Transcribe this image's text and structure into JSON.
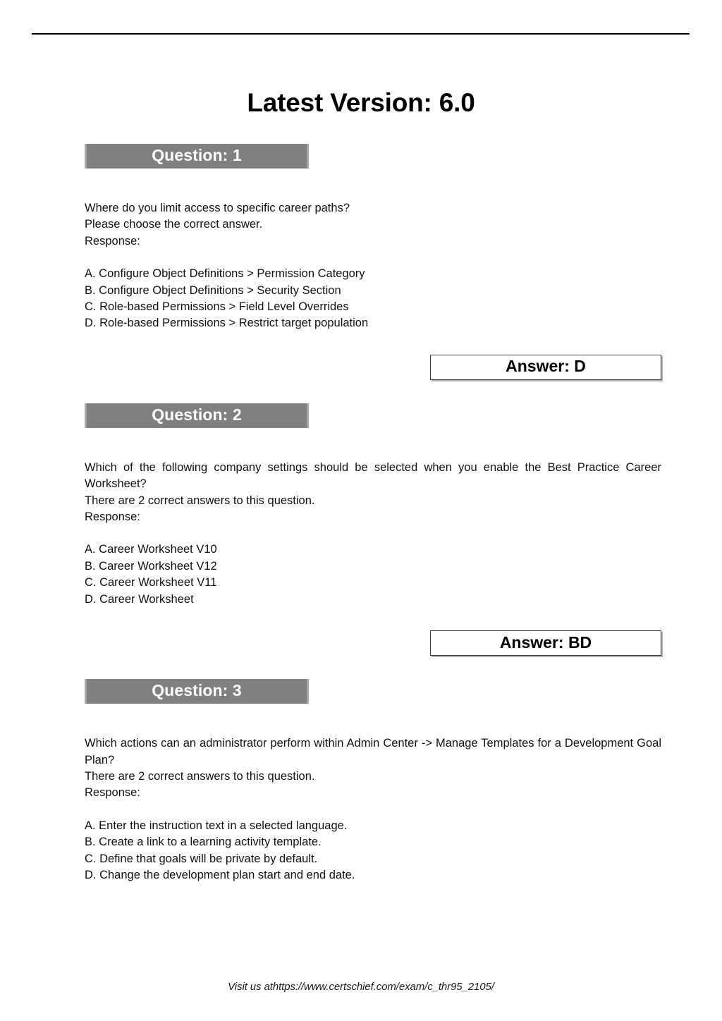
{
  "document": {
    "title": "Latest Version: 6.0",
    "footer_text": "Visit us athttps://www.certschief.com/exam/c_thr95_2105/"
  },
  "colors": {
    "banner_gray": "#808080",
    "banner_edge_gray": "#a6a6a6",
    "banner_text": "#ffffff",
    "answer_border": "#3a3a3a",
    "body_text": "#111111",
    "rule": "#000000"
  },
  "questions": [
    {
      "banner_label": "Question: 1",
      "justified": false,
      "stem": "Where do you limit access to specific career paths?",
      "instruction": "Please choose the correct answer.",
      "response_label": "Response:",
      "options": [
        "A. Configure Object Definitions > Permission Category",
        "B. Configure Object Definitions > Security Section",
        "C. Role-based Permissions > Field Level Overrides",
        "D. Role-based Permissions > Restrict target population"
      ],
      "answer_label": "Answer: D"
    },
    {
      "banner_label": "Question: 2",
      "justified": true,
      "stem": "Which of the following company settings should be selected when you enable the Best Practice Career Worksheet?",
      "instruction": "There are 2 correct answers to this question.",
      "response_label": "Response:",
      "options": [
        "A. Career Worksheet V10",
        "B. Career Worksheet V12",
        "C. Career Worksheet V11",
        "D. Career Worksheet"
      ],
      "answer_label": "Answer: BD"
    },
    {
      "banner_label": "Question: 3",
      "justified": true,
      "stem": "Which actions can an administrator perform within Admin Center -> Manage Templates for a Development Goal Plan?",
      "instruction": "There are 2 correct answers to this question.",
      "response_label": "Response:",
      "options": [
        "A. Enter the instruction text in a selected language.",
        "B. Create a link to a learning activity template.",
        "C. Define that goals will be private by default.",
        "D. Change the development plan start and end date."
      ],
      "answer_label": null
    }
  ]
}
